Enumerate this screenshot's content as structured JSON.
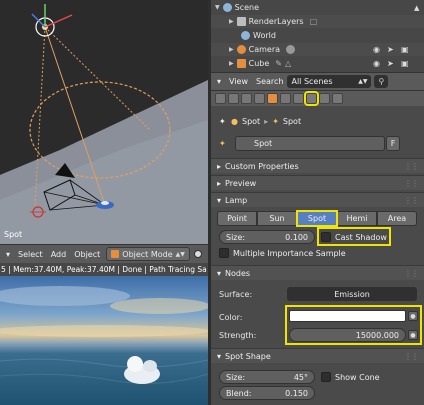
{
  "viewport": {
    "object_label": "Spot",
    "header": {
      "select": "Select",
      "add": "Add",
      "object": "Object",
      "mode": "Object Mode"
    },
    "infobar": "5 | Mem:37.40M, Peak:37.40M | Done | Path Tracing Sa"
  },
  "outliner": {
    "rows": [
      {
        "label": "Scene",
        "icon_color": "#8fb4d9"
      },
      {
        "label": "RenderLayers",
        "icon_color": "#bdbdbd"
      },
      {
        "label": "World",
        "icon_color": "#8fb4d9"
      },
      {
        "label": "Camera",
        "icon_color": "#e58f3e"
      },
      {
        "label": "Cube",
        "icon_color": "#e58f3e"
      }
    ],
    "header": {
      "view": "View",
      "search": "Search",
      "scene_filter": "All Scenes"
    }
  },
  "properties": {
    "breadcrumb": {
      "item1": "Spot",
      "item2": "Spot"
    },
    "lamp_name": "Spot",
    "fake_user": "F",
    "panels": {
      "custom_props": "Custom Properties",
      "preview": "Preview",
      "lamp": "Lamp",
      "nodes": "Nodes",
      "spot_shape": "Spot Shape"
    },
    "lamp_types": [
      "Point",
      "Sun",
      "Spot",
      "Hemi",
      "Area"
    ],
    "lamp_type_active": "Spot",
    "size_label": "Size:",
    "size_value": "0.100",
    "cast_shadow": "Cast Shadow",
    "mis": "Multiple Importance Sample",
    "surface_label": "Surface:",
    "surface_value": "Emission",
    "color_label": "Color:",
    "color_value": "#ffffff",
    "strength_label": "Strength:",
    "strength_value": "15000.000",
    "spot_size_label": "Size:",
    "spot_size_value": "45°",
    "show_cone": "Show Cone",
    "blend_label": "Blend:",
    "blend_value": "0.150"
  },
  "colors": {
    "highlight": "#f0e400",
    "active_blue": "#5680c2"
  }
}
